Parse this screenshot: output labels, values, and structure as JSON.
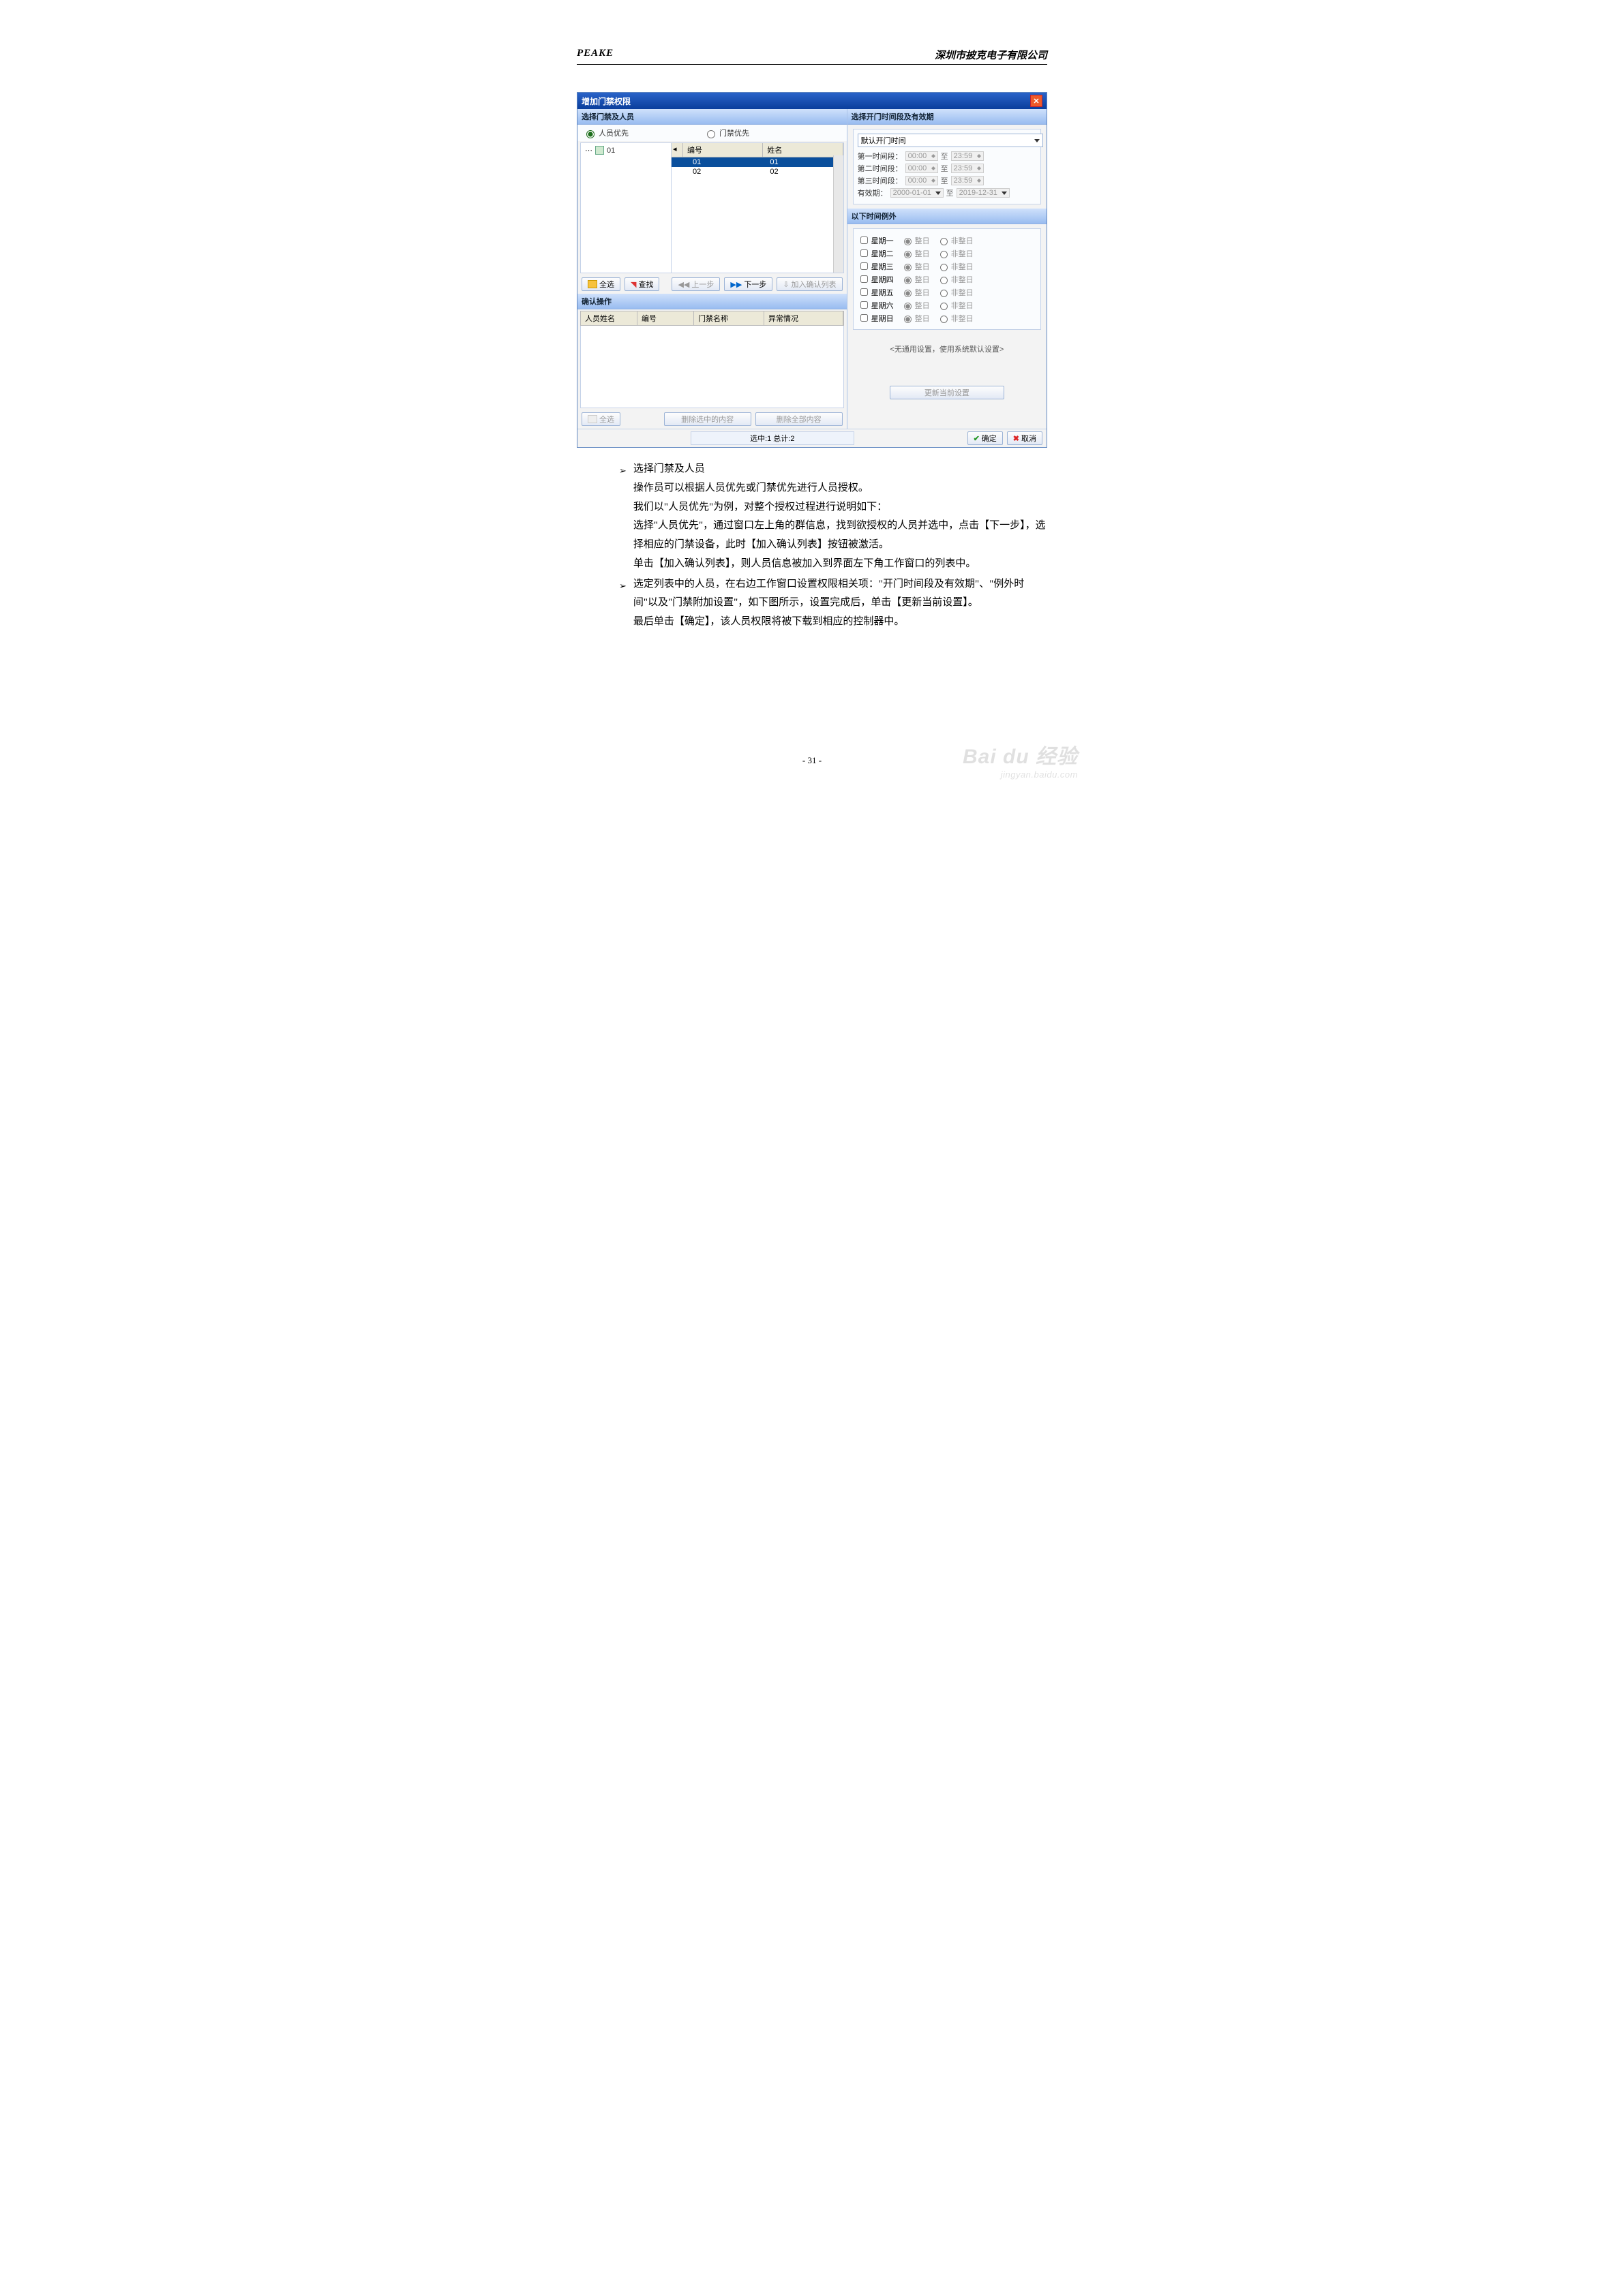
{
  "header": {
    "left": "PEAKE",
    "right": "深圳市披克电子有限公司"
  },
  "dialog": {
    "title": "增加门禁权限",
    "left_hdr": "选择门禁及人员",
    "right_hdr": "选择开门时间段及有效期",
    "radio": {
      "person": "人员优先",
      "door": "门禁优先"
    },
    "tree_node": "01",
    "list": {
      "col1": "编号",
      "col2": "姓名",
      "rows": [
        [
          "01",
          "01"
        ],
        [
          "02",
          "02"
        ]
      ]
    },
    "btns": {
      "all": "全选",
      "find": "查找",
      "prev": "上一步",
      "next": "下一步",
      "add": "加入确认列表"
    },
    "confirm_hdr": "确认操作",
    "confirm_cols": {
      "c1": "人员姓名",
      "c2": "编号",
      "c3": "门禁名称",
      "c4": "异常情况"
    },
    "confirm_btns": {
      "all": "全选",
      "delsel": "删除选中的内容",
      "delall": "删除全部内容"
    },
    "time": {
      "dropdown": "默认开门时间",
      "seg1": "第一时间段：",
      "seg2": "第二时间段：",
      "seg3": "第三时间段：",
      "from": "00:00",
      "to_lab": "至",
      "to": "23:59",
      "valid": "有效期：",
      "d1": "2000-01-01",
      "d2": "2019-12-31"
    },
    "exc_hdr": "以下时间例外",
    "days": [
      "星期一",
      "星期二",
      "星期三",
      "星期四",
      "星期五",
      "星期六",
      "星期日"
    ],
    "full": "整日",
    "notfull": "非整日",
    "note": "<无通用设置，使用系统默认设置>",
    "update": "更新当前设置",
    "status": "选中:1 总计:2",
    "ok": "确定",
    "cancel": "取消"
  },
  "body": {
    "b1": {
      "title": "选择门禁及人员",
      "lines": [
        "操作员可以根据人员优先或门禁优先进行人员授权。",
        "我们以\"人员优先\"为例，对整个授权过程进行说明如下：",
        "选择\"人员优先\"，通过窗口左上角的群信息，找到欲授权的人员并选中，点击【下一步】，选择相应的门禁设备，此时【加入确认列表】按钮被激活。",
        "单击【加入确认列表】，则人员信息被加入到界面左下角工作窗口的列表中。"
      ]
    },
    "b2": {
      "lines": [
        "选定列表中的人员，在右边工作窗口设置权限相关项：\"开门时间段及有效期\"、\"例外时间\"以及\"门禁附加设置\"，如下图所示，设置完成后，单击【更新当前设置】。",
        "最后单击【确定】，该人员权限将被下载到相应的控制器中。"
      ]
    }
  },
  "page_num": "- 31 -",
  "watermark": {
    "big": "Bai du 经验",
    "sm": "jingyan.baidu.com"
  }
}
